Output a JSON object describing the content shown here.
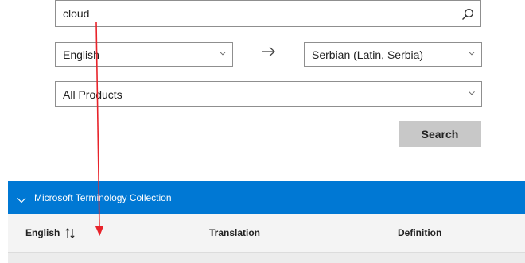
{
  "search": {
    "query": "cloud",
    "icon": "search-icon"
  },
  "from_language": {
    "selected": "English"
  },
  "to_language": {
    "selected": "Serbian (Latin, Serbia)"
  },
  "swap_icon": "arrow-right-icon",
  "product": {
    "selected": "All Products"
  },
  "search_button": {
    "label": "Search"
  },
  "collection": {
    "title": "Microsoft Terminology Collection"
  },
  "table": {
    "columns": [
      "English",
      "Translation",
      "Definition"
    ]
  },
  "colors": {
    "accent": "#0078d4",
    "annotation": "#e8232a",
    "button": "#c8c8c8"
  }
}
